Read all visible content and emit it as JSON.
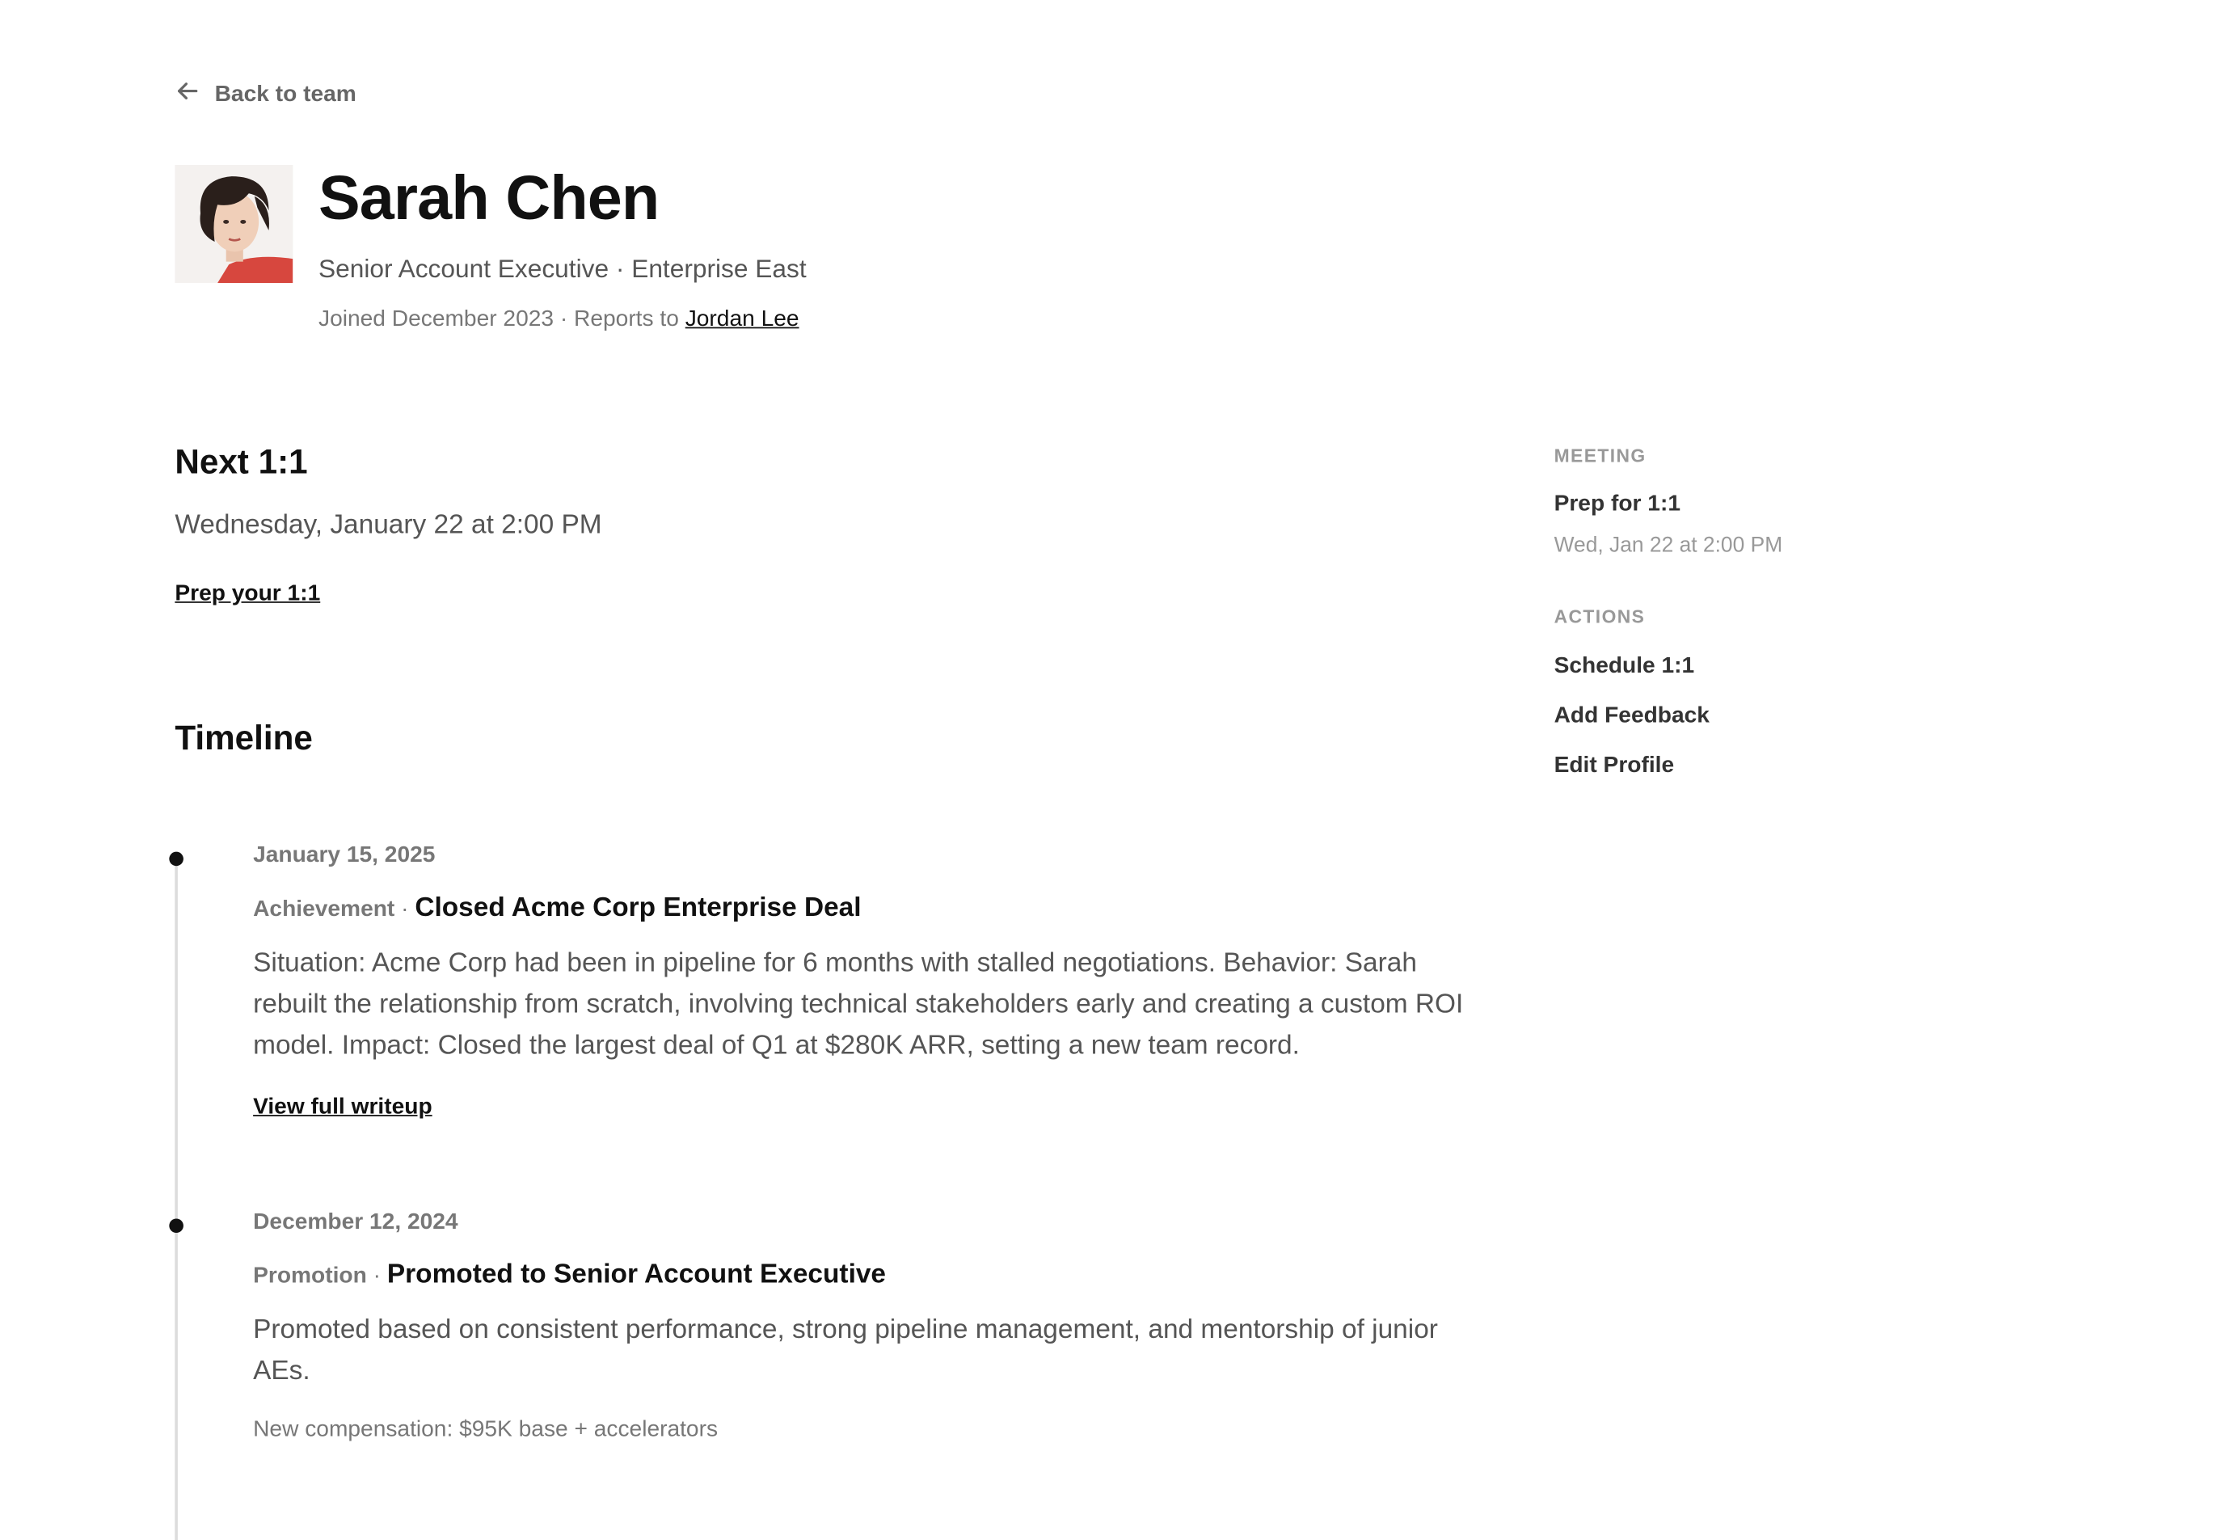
{
  "nav": {
    "back_label": "Back to team"
  },
  "profile": {
    "name": "Sarah Chen",
    "title_line": "Senior Account Executive · Enterprise East",
    "joined": "Joined December 2023 · Reports to",
    "manager": "Jordan Lee"
  },
  "next_one_on_one": {
    "heading": "Next 1:1",
    "datetime": "Wednesday, January 22 at 2:00 PM",
    "prep_label": "Prep your 1:1"
  },
  "timeline": {
    "heading": "Timeline",
    "entries": [
      {
        "date": "January 15, 2025",
        "type": "Achievement",
        "separator": "·",
        "title": "Closed Acme Corp Enterprise Deal",
        "description": "Situation: Acme Corp had been in pipeline for 6 months with stalled negotiations. Behavior: Sarah rebuilt the relationship from scratch, involving technical stakeholders early and creating a custom ROI model. Impact: Closed the largest deal of Q1 at $280K ARR, setting a new team record.",
        "link_label": "View full writeup"
      },
      {
        "date": "December 12, 2024",
        "type": "Promotion",
        "separator": "·",
        "title": "Promoted to Senior Account Executive",
        "description": "Promoted based on consistent performance, strong pipeline management, and mentorship of junior AEs.",
        "note": "New compensation: $95K base + accelerators"
      }
    ]
  },
  "sidebar": {
    "meeting_label": "MEETING",
    "meeting_title": "Prep for 1:1",
    "meeting_time": "Wed, Jan 22 at 2:00 PM",
    "actions_label": "ACTIONS",
    "actions": [
      "Schedule 1:1",
      "Add Feedback",
      "Edit Profile"
    ]
  },
  "icons": {
    "back": "arrow-left-icon",
    "avatar": "profile-photo"
  },
  "colors": {
    "text": "#111111",
    "muted": "#777777",
    "label": "#999999",
    "timeline_line": "#dcdcdc"
  }
}
